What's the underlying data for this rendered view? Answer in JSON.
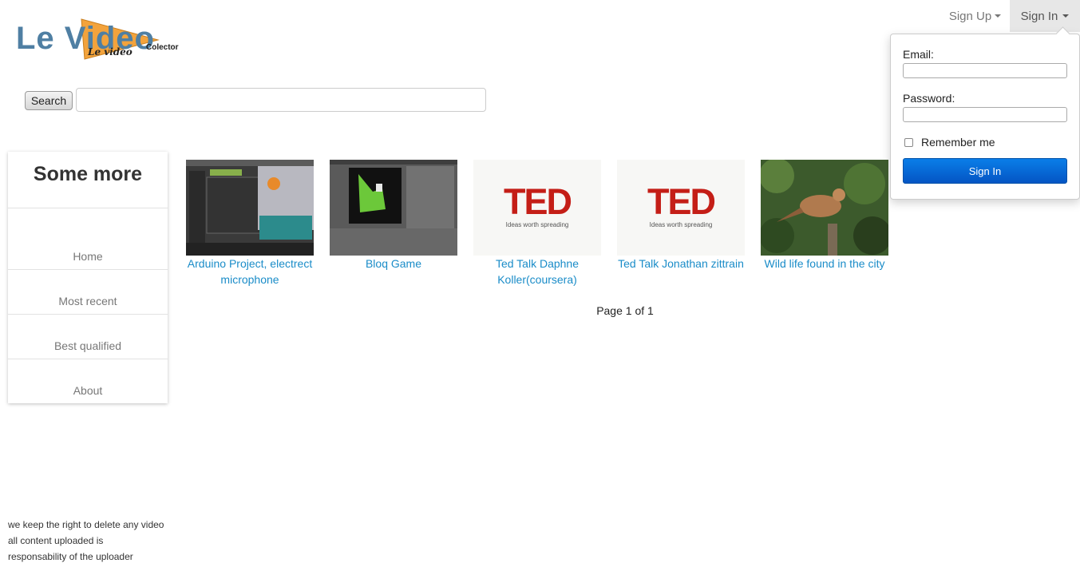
{
  "logo": {
    "title": "Le Video",
    "subtitle": "Le video",
    "tag": "Colector"
  },
  "search": {
    "button_label": "Search",
    "placeholder": ""
  },
  "nav": {
    "signup_label": "Sign Up",
    "signin_label": "Sign In"
  },
  "signin": {
    "email_label": "Email:",
    "password_label": "Password:",
    "remember_label": "Remember me",
    "button_label": "Sign In",
    "email_value": "",
    "password_value": ""
  },
  "sidebar": {
    "title": "Some more",
    "items": [
      {
        "label": "Home"
      },
      {
        "label": "Most recent"
      },
      {
        "label": "Best qualified"
      },
      {
        "label": "About"
      }
    ]
  },
  "videos": [
    {
      "title": "Arduino Project, electrect microphone",
      "thumb": "arduino-screenshot"
    },
    {
      "title": "Bloq Game",
      "thumb": "blender-screenshot"
    },
    {
      "title": "Ted Talk Daphne Koller(coursera)",
      "thumb": "ted-logo",
      "ted_word": "TED",
      "ted_tag": "Ideas worth spreading"
    },
    {
      "title": "Ted Talk Jonathan zittrain",
      "thumb": "ted-logo",
      "ted_word": "TED",
      "ted_tag": "Ideas worth spreading"
    },
    {
      "title": "Wild life found in the city",
      "thumb": "bird-photo"
    }
  ],
  "pager": {
    "text": "Page 1 of 1"
  },
  "footer": {
    "lines": [
      "we keep the right to delete any video",
      "all content uploaded is",
      "responsability of the uploader"
    ]
  },
  "colors": {
    "link": "#1a8cc8",
    "logo": "#4f7fa3",
    "logo_triangle": "#f3a33c",
    "signin_button": "#0a6ad8"
  }
}
